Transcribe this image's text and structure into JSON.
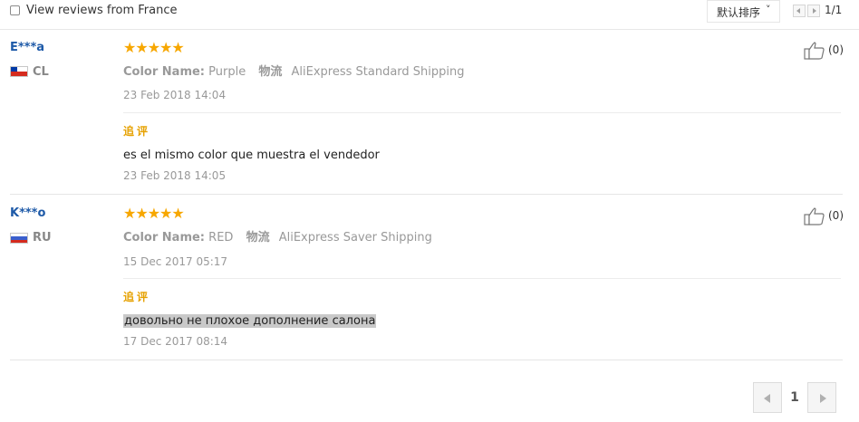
{
  "toolbar": {
    "filter_label": "View reviews from France",
    "sort_label": "默认排序",
    "sort_caret": "˅",
    "page_count": "1/1"
  },
  "reviews": [
    {
      "user": "E***a",
      "country": "CL",
      "stars": "★★★★★",
      "rating": 5,
      "color_key": "Color Name:",
      "color_value": "Purple",
      "shipping_key": "物流",
      "shipping_value": "AliExpress Standard Shipping",
      "date": "23 Feb 2018 14:04",
      "additional_label": "追评",
      "additional_text": "es el mismo color que muestra el vendedor",
      "additional_date": "23 Feb 2018 14:05",
      "helpful": "(0)"
    },
    {
      "user": "K***o",
      "country": "RU",
      "stars": "★★★★★",
      "rating": 5,
      "color_key": "Color Name:",
      "color_value": "RED",
      "shipping_key": "物流",
      "shipping_value": "AliExpress Saver Shipping",
      "date": "15 Dec 2017 05:17",
      "additional_label": "追评",
      "additional_text": "довольно не плохое дополнение салона",
      "additional_date": "17 Dec 2017 08:14",
      "helpful": "(0)"
    }
  ],
  "pagination": {
    "current": "1"
  },
  "colors": {
    "accent": "#f7a700",
    "username": "#1e5aa8",
    "muted": "#999999"
  }
}
